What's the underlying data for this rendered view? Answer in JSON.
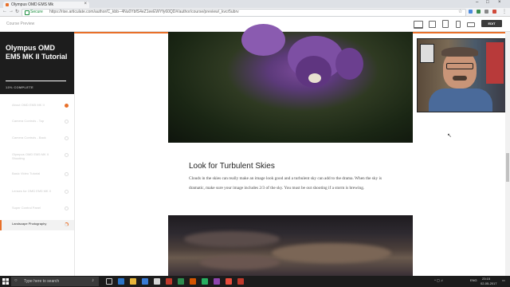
{
  "browser": {
    "tab_title": "Olympus OMD EMS Mk",
    "secure_label": "Secure",
    "url": "https://rise.articulate.com/author/C_kbb--4Nu0YbfS4eZ1eeEWYfy60QD#/author/course/preview/_kvcr5ubrv"
  },
  "preview": {
    "title": "Course Preview",
    "edit_label": "EDIT"
  },
  "sidebar": {
    "course_title": "Olympus OMD EM5 MK II Tutorial",
    "progress": "13% COMPLETE",
    "items": [
      {
        "label": "About OMD EM5 MK II",
        "status": "done"
      },
      {
        "label": "Camera Controls - Top",
        "status": "none"
      },
      {
        "label": "Camera Controls - Back",
        "status": "none"
      },
      {
        "label": "Olympus OMD EM5 MK II Shooting",
        "status": "none"
      },
      {
        "label": "Basic Video Tutorial",
        "status": "none"
      },
      {
        "label": "Lenses for OMD EM5 MK II",
        "status": "none"
      },
      {
        "label": "Super Control Panel",
        "status": "none"
      },
      {
        "label": "Landscape Photography",
        "status": "partial",
        "active": true
      }
    ]
  },
  "content": {
    "heading": "Look for Turbulent Skies",
    "paragraph": "Clouds in the skies can really make an image look good and a turbulent sky can add to the drama. When the sky is dramatic, make sure your image includes 2/3 of the sky. You must be out shooting if a storm is brewing."
  },
  "taskbar": {
    "search_placeholder": "Type here to search",
    "lang": "ENG",
    "time": "23:15",
    "date": "02-05-2017"
  }
}
